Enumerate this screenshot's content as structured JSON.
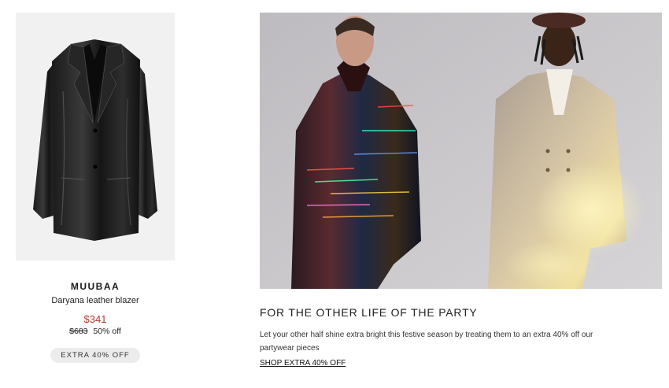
{
  "product": {
    "brand": "MUUBAA",
    "name": "Daryana leather blazer",
    "sale_price": "$341",
    "original_price": "$683",
    "discount": "50% off",
    "offer_badge": "EXTRA 40% OFF",
    "image": "black-leather-blazer"
  },
  "editorial": {
    "image": "two-models-in-party-blazers",
    "headline": "FOR THE OTHER LIFE OF THE PARTY",
    "body": "Let your other half shine extra bright this festive season by treating them to an extra 40% off our partywear pieces",
    "cta_label": "SHOP EXTRA 40% OFF"
  },
  "colors": {
    "sale_price": "#b03a2e",
    "pill_background": "#ececec",
    "product_image_background": "#f1f1f1",
    "hero_background": "#c9c7c9"
  }
}
